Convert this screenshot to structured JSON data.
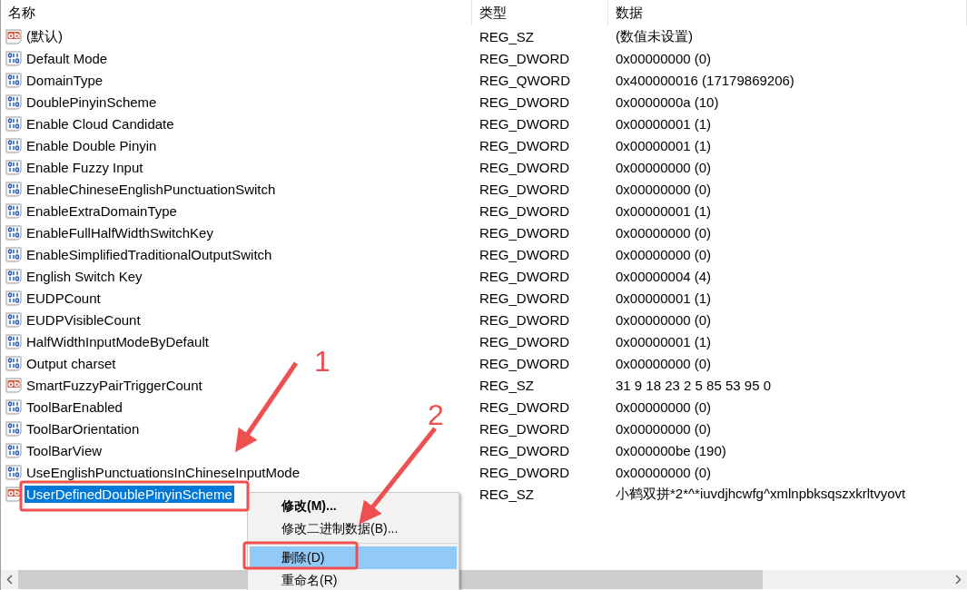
{
  "columns": [
    "名称",
    "类型",
    "数据"
  ],
  "rows": [
    {
      "kind": "string",
      "name": "(默认)",
      "type": "REG_SZ",
      "data": "(数值未设置)",
      "selected": false
    },
    {
      "kind": "binary",
      "name": "Default Mode",
      "type": "REG_DWORD",
      "data": "0x00000000 (0)",
      "selected": false
    },
    {
      "kind": "binary",
      "name": "DomainType",
      "type": "REG_QWORD",
      "data": "0x400000016 (17179869206)",
      "selected": false
    },
    {
      "kind": "binary",
      "name": "DoublePinyinScheme",
      "type": "REG_DWORD",
      "data": "0x0000000a (10)",
      "selected": false
    },
    {
      "kind": "binary",
      "name": "Enable Cloud Candidate",
      "type": "REG_DWORD",
      "data": "0x00000001 (1)",
      "selected": false
    },
    {
      "kind": "binary",
      "name": "Enable Double Pinyin",
      "type": "REG_DWORD",
      "data": "0x00000001 (1)",
      "selected": false
    },
    {
      "kind": "binary",
      "name": "Enable Fuzzy Input",
      "type": "REG_DWORD",
      "data": "0x00000000 (0)",
      "selected": false
    },
    {
      "kind": "binary",
      "name": "EnableChineseEnglishPunctuationSwitch",
      "type": "REG_DWORD",
      "data": "0x00000000 (0)",
      "selected": false
    },
    {
      "kind": "binary",
      "name": "EnableExtraDomainType",
      "type": "REG_DWORD",
      "data": "0x00000001 (1)",
      "selected": false
    },
    {
      "kind": "binary",
      "name": "EnableFullHalfWidthSwitchKey",
      "type": "REG_DWORD",
      "data": "0x00000000 (0)",
      "selected": false
    },
    {
      "kind": "binary",
      "name": "EnableSimplifiedTraditionalOutputSwitch",
      "type": "REG_DWORD",
      "data": "0x00000000 (0)",
      "selected": false
    },
    {
      "kind": "binary",
      "name": "English Switch Key",
      "type": "REG_DWORD",
      "data": "0x00000004 (4)",
      "selected": false
    },
    {
      "kind": "binary",
      "name": "EUDPCount",
      "type": "REG_DWORD",
      "data": "0x00000001 (1)",
      "selected": false
    },
    {
      "kind": "binary",
      "name": "EUDPVisibleCount",
      "type": "REG_DWORD",
      "data": "0x00000000 (0)",
      "selected": false
    },
    {
      "kind": "binary",
      "name": "HalfWidthInputModeByDefault",
      "type": "REG_DWORD",
      "data": "0x00000001 (1)",
      "selected": false
    },
    {
      "kind": "binary",
      "name": "Output charset",
      "type": "REG_DWORD",
      "data": "0x00000000 (0)",
      "selected": false
    },
    {
      "kind": "string",
      "name": "SmartFuzzyPairTriggerCount",
      "type": "REG_SZ",
      "data": "31 9 18 23 2 5 85 53 95 0",
      "selected": false
    },
    {
      "kind": "binary",
      "name": "ToolBarEnabled",
      "type": "REG_DWORD",
      "data": "0x00000000 (0)",
      "selected": false
    },
    {
      "kind": "binary",
      "name": "ToolBarOrientation",
      "type": "REG_DWORD",
      "data": "0x00000000 (0)",
      "selected": false
    },
    {
      "kind": "binary",
      "name": "ToolBarView",
      "type": "REG_DWORD",
      "data": "0x000000be (190)",
      "selected": false
    },
    {
      "kind": "binary",
      "name": "UseEnglishPunctuationsInChineseInputMode",
      "type": "REG_DWORD",
      "data": "0x00000000 (0)",
      "selected": false
    },
    {
      "kind": "string",
      "name": "UserDefinedDoublePinyinScheme",
      "type": "REG_SZ",
      "data": "小鹤双拼*2*^*iuvdjhcwfg^xmlnpbksqszxkrltvyovt",
      "selected": true
    }
  ],
  "context_menu": [
    {
      "kind": "item",
      "label": "修改(M)...",
      "default": true,
      "selected": false
    },
    {
      "kind": "item",
      "label": "修改二进制数据(B)...",
      "default": false,
      "selected": false
    },
    {
      "kind": "separator"
    },
    {
      "kind": "item",
      "label": "删除(D)",
      "default": false,
      "selected": true
    },
    {
      "kind": "item",
      "label": "重命名(R)",
      "default": false,
      "selected": false
    }
  ],
  "annotations": [
    {
      "label": "1"
    },
    {
      "label": "2"
    }
  ]
}
